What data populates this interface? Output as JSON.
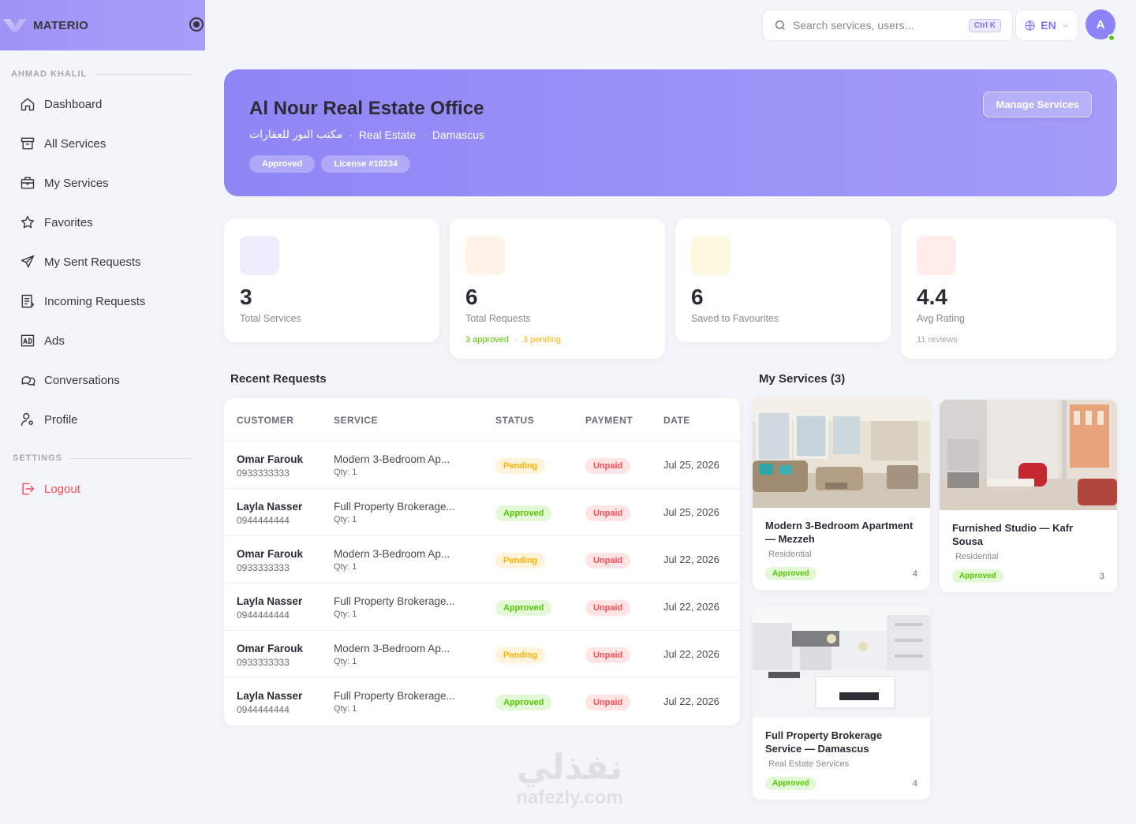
{
  "brand": {
    "name": "MATERIO"
  },
  "sidebar": {
    "section_user": "AHMAD KHALIL",
    "items": [
      {
        "label": "Dashboard",
        "icon": "home-icon"
      },
      {
        "label": "All Services",
        "icon": "archive-icon"
      },
      {
        "label": "My Services",
        "icon": "briefcase-icon"
      },
      {
        "label": "Favorites",
        "icon": "star-icon"
      },
      {
        "label": "My Sent Requests",
        "icon": "send-icon"
      },
      {
        "label": "Incoming Requests",
        "icon": "list-icon"
      },
      {
        "label": "Ads",
        "icon": "ad-icon"
      },
      {
        "label": "Conversations",
        "icon": "chat-icon"
      },
      {
        "label": "Profile",
        "icon": "user-settings-icon"
      }
    ],
    "section_settings": "SETTINGS",
    "logout": "Logout"
  },
  "topbar": {
    "search_placeholder": "Search services, users...",
    "shortcut": "Ctrl K",
    "language": "EN",
    "avatar_initial": "A"
  },
  "hero": {
    "title": "Al Nour Real Estate Office",
    "arabic_name": "مكتب النور للعقارات",
    "category": "Real Estate",
    "city": "Damascus",
    "chip_status": "Approved",
    "chip_license": "License #10234",
    "manage_button": "Manage Services"
  },
  "stats": [
    {
      "value": "3",
      "label": "Total Services",
      "color": "#eeedfe"
    },
    {
      "value": "6",
      "label": "Total Requests",
      "color": "#fff3e8",
      "approved": "3 approved",
      "sep": "·",
      "pending": "3 pending"
    },
    {
      "value": "6",
      "label": "Saved to Favourites",
      "color": "#fff8e0"
    },
    {
      "value": "4.4",
      "label": "Avg Rating",
      "color": "#ffeceb",
      "note": "11 reviews"
    }
  ],
  "recent": {
    "title": "Recent Requests",
    "headers": {
      "customer": "CUSTOMER",
      "service": "SERVICE",
      "status": "STATUS",
      "payment": "PAYMENT",
      "date": "DATE"
    },
    "rows": [
      {
        "name": "Omar Farouk",
        "phone": "0933333333",
        "service": "Modern 3-Bedroom Ap...",
        "qty": "Qty: 1",
        "status": "Pending",
        "payment": "Unpaid",
        "date": "Jul 25, 2026"
      },
      {
        "name": "Layla Nasser",
        "phone": "0944444444",
        "service": "Full Property Brokerage...",
        "qty": "Qty: 1",
        "status": "Approved",
        "payment": "Unpaid",
        "date": "Jul 25, 2026"
      },
      {
        "name": "Omar Farouk",
        "phone": "0933333333",
        "service": "Modern 3-Bedroom Ap...",
        "qty": "Qty: 1",
        "status": "Pending",
        "payment": "Unpaid",
        "date": "Jul 22, 2026"
      },
      {
        "name": "Layla Nasser",
        "phone": "0944444444",
        "service": "Full Property Brokerage...",
        "qty": "Qty: 1",
        "status": "Approved",
        "payment": "Unpaid",
        "date": "Jul 22, 2026"
      },
      {
        "name": "Omar Farouk",
        "phone": "0933333333",
        "service": "Modern 3-Bedroom Ap...",
        "qty": "Qty: 1",
        "status": "Pending",
        "payment": "Unpaid",
        "date": "Jul 22, 2026"
      },
      {
        "name": "Layla Nasser",
        "phone": "0944444444",
        "service": "Full Property Brokerage...",
        "qty": "Qty: 1",
        "status": "Approved",
        "payment": "Unpaid",
        "date": "Jul 22, 2026"
      }
    ]
  },
  "services": {
    "title": "My Services (3)",
    "cards": [
      {
        "title": "Modern 3-Bedroom Apartment — Mezzeh",
        "category": "Residential",
        "status": "Approved",
        "count": "4"
      },
      {
        "title": "Furnished Studio — Kafr Sousa",
        "category": "Residential",
        "status": "Approved",
        "count": "3"
      },
      {
        "title": "Full Property Brokerage Service — Damascus",
        "category": "Real Estate Services",
        "status": "Approved",
        "count": "4"
      }
    ]
  },
  "watermark": {
    "arabic": "نفذلي",
    "latin": "nafezly.com"
  }
}
